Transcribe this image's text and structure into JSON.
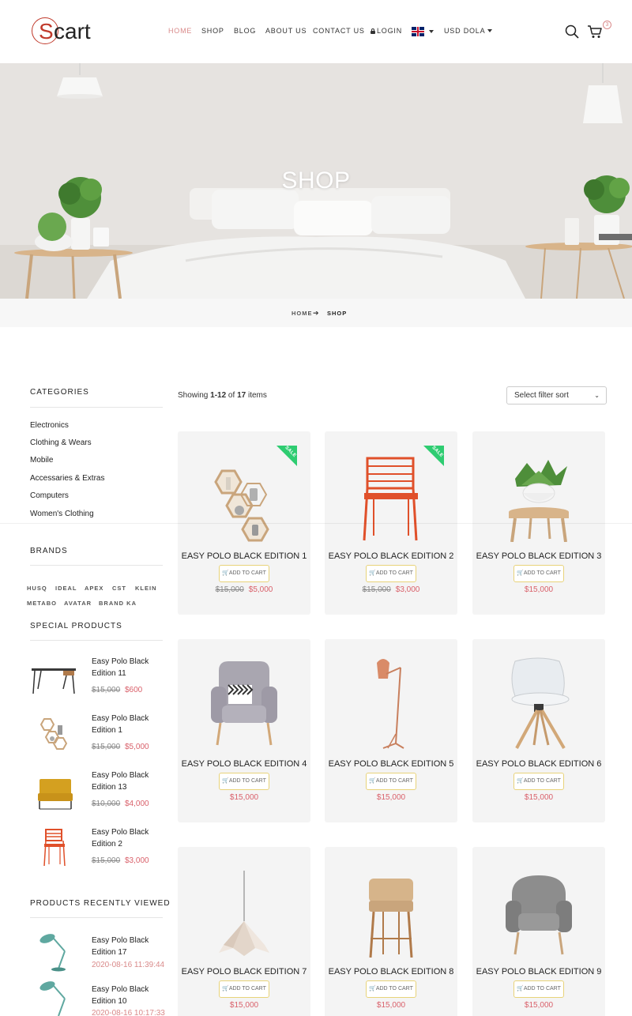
{
  "header": {
    "logo_first": "S",
    "logo_rest": "cart",
    "nav": {
      "home": "HOME",
      "shop": "SHOP",
      "blog": "BLOG",
      "about": "ABOUT US",
      "contact": "CONTACT US",
      "login": "LOGIN"
    },
    "currency": "USD DOLA",
    "cart_count": "3"
  },
  "hero": {
    "title": "SHOP"
  },
  "breadcrumb": {
    "home": "HOME",
    "current": "SHOP"
  },
  "sidebar": {
    "categories_title": "CATEGORIES",
    "categories": [
      "Electronics",
      "Clothing & Wears",
      "Mobile",
      "Accessaries & Extras",
      "Computers",
      "Women's Clothing"
    ],
    "brands_title": "BRANDS",
    "brands": [
      "HUSQ",
      "IDEAL",
      "APEX",
      "CST",
      "KLEIN",
      "METABO",
      "AVATAR",
      "BRAND KA"
    ],
    "special_title": "SPECIAL PRODUCTS",
    "special": [
      {
        "name": "Easy Polo Black Edition 11",
        "old": "$15,000",
        "new": "$600"
      },
      {
        "name": "Easy Polo Black Edition 1",
        "old": "$15,000",
        "new": "$5,000"
      },
      {
        "name": "Easy Polo Black Edition 13",
        "old": "$10,000",
        "new": "$4,000"
      },
      {
        "name": "Easy Polo Black Edition 2",
        "old": "$15,000",
        "new": "$3,000"
      }
    ],
    "recent_title": "PRODUCTS RECENTLY VIEWED",
    "recent": [
      {
        "name": "Easy Polo Black Edition 17",
        "date": "2020-08-16 11:39:44"
      },
      {
        "name": "Easy Polo Black Edition 10",
        "date": "2020-08-16 10:17:33"
      }
    ]
  },
  "main": {
    "showing_prefix": "Showing ",
    "showing_range": "1-12",
    "showing_of": " of ",
    "showing_total": "17",
    "showing_suffix": " items",
    "sort_placeholder": "Select filter sort",
    "add_to_cart": "ADD TO CART",
    "sale_label": "SALE",
    "products": [
      {
        "title": "EASY POLO BLACK EDITION 1",
        "old": "$15,000",
        "price": "$5,000",
        "sale": true
      },
      {
        "title": "EASY POLO BLACK EDITION 2",
        "old": "$15,000",
        "price": "$3,000",
        "sale": true
      },
      {
        "title": "EASY POLO BLACK EDITION 3",
        "old": "",
        "price": "$15,000",
        "sale": false
      },
      {
        "title": "EASY POLO BLACK EDITION 4",
        "old": "",
        "price": "$15,000",
        "sale": false
      },
      {
        "title": "EASY POLO BLACK EDITION 5",
        "old": "",
        "price": "$15,000",
        "sale": false
      },
      {
        "title": "EASY POLO BLACK EDITION 6",
        "old": "",
        "price": "$15,000",
        "sale": false
      },
      {
        "title": "EASY POLO BLACK EDITION 7",
        "old": "",
        "price": "$15,000",
        "sale": false
      },
      {
        "title": "EASY POLO BLACK EDITION 8",
        "old": "",
        "price": "$15,000",
        "sale": false
      },
      {
        "title": "EASY POLO BLACK EDITION 9",
        "old": "",
        "price": "$15,000",
        "sale": false
      }
    ]
  },
  "colors": {
    "accent": "#d98a8a",
    "price": "#d9606a",
    "sale": "#2ecc71",
    "button_border": "#e8d37a",
    "card_bg": "#f4f4f4"
  },
  "icons": {
    "search": "search-icon",
    "cart": "cart-icon",
    "lock": "lock-icon",
    "flag": "uk-flag-icon"
  }
}
